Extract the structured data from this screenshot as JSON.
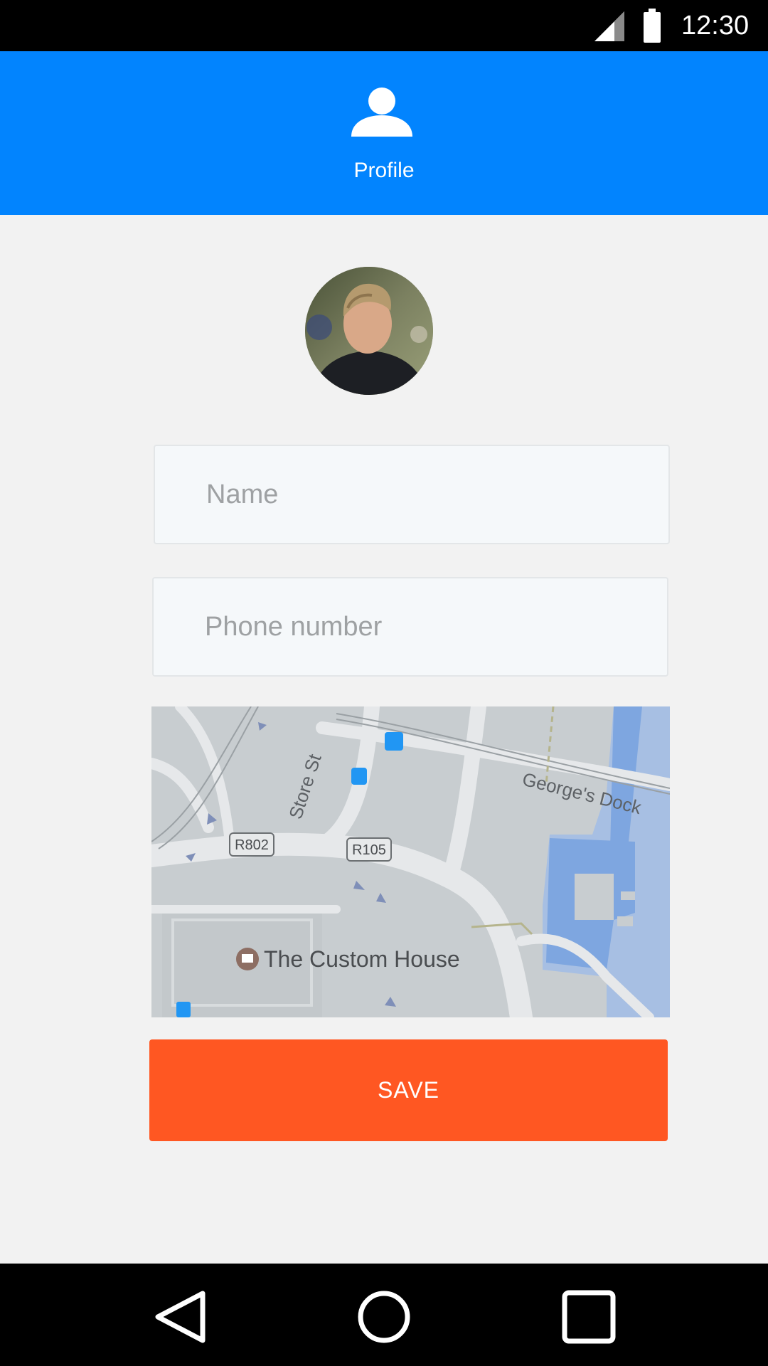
{
  "status_bar": {
    "time": "12:30",
    "icons": [
      "signal-icon",
      "battery-icon"
    ]
  },
  "header": {
    "icon": "person-icon",
    "title": "Profile",
    "background_color": "#0284fe"
  },
  "form": {
    "avatar": "profile-photo",
    "name_placeholder": "Name",
    "phone_placeholder": "Phone number",
    "save_label": "SAVE",
    "save_color": "#ff5722"
  },
  "map": {
    "road_labels": [
      "Store St",
      "George's Dock"
    ],
    "route_markers": [
      "R802",
      "R105"
    ],
    "place_label": "The Custom House"
  },
  "nav_bar": {
    "icons": [
      "back-icon",
      "home-icon",
      "recents-icon"
    ]
  }
}
